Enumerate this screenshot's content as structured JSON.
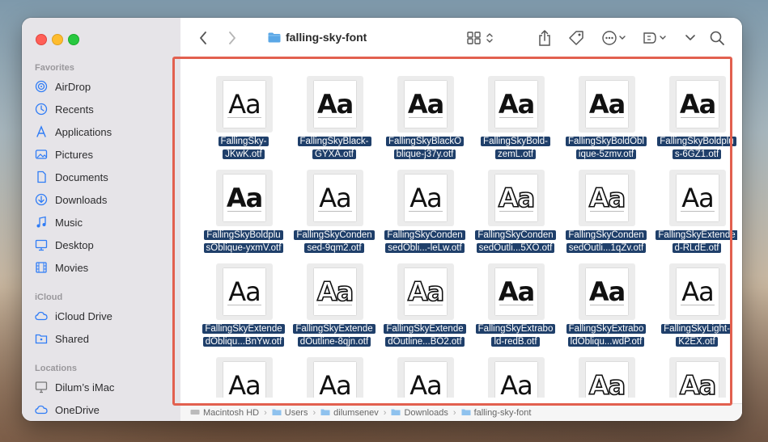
{
  "window": {
    "title": "falling-sky-font",
    "highlight_color": "#e2604f"
  },
  "sidebar": {
    "favorites_title": "Favorites",
    "favorites": [
      {
        "label": "AirDrop",
        "icon": "airdrop-icon"
      },
      {
        "label": "Recents",
        "icon": "clock-icon"
      },
      {
        "label": "Applications",
        "icon": "applications-icon"
      },
      {
        "label": "Pictures",
        "icon": "pictures-icon"
      },
      {
        "label": "Documents",
        "icon": "document-icon"
      },
      {
        "label": "Downloads",
        "icon": "download-icon"
      },
      {
        "label": "Music",
        "icon": "music-icon"
      },
      {
        "label": "Desktop",
        "icon": "desktop-icon"
      },
      {
        "label": "Movies",
        "icon": "movies-icon"
      }
    ],
    "icloud_title": "iCloud",
    "icloud": [
      {
        "label": "iCloud Drive",
        "icon": "cloud-icon"
      },
      {
        "label": "Shared",
        "icon": "shared-folder-icon"
      }
    ],
    "locations_title": "Locations",
    "locations": [
      {
        "label": "Dilum’s iMac",
        "icon": "imac-icon"
      },
      {
        "label": "OneDrive",
        "icon": "cloud-icon"
      }
    ]
  },
  "files": [
    {
      "line1": "FallingSky-",
      "line2": "JKwK.otf",
      "style": "regular"
    },
    {
      "line1": "FallingSkyBlack-",
      "line2": "GYXA.otf",
      "style": "black"
    },
    {
      "line1": "FallingSkyBlackO",
      "line2": "blique-j37y.otf",
      "style": "black"
    },
    {
      "line1": "FallingSkyBold-",
      "line2": "zemL.otf",
      "style": "black"
    },
    {
      "line1": "FallingSkyBoldObl",
      "line2": "ique-5zmv.otf",
      "style": "black"
    },
    {
      "line1": "FallingSkyBoldplu",
      "line2": "s-6GZ1.otf",
      "style": "black"
    },
    {
      "line1": "FallingSkyBoldplu",
      "line2": "sOblique-yxmV.otf",
      "style": "black"
    },
    {
      "line1": "FallingSkyConden",
      "line2": "sed-9qm2.otf",
      "style": "regular"
    },
    {
      "line1": "FallingSkyConden",
      "line2": "sedObli...-leLw.otf",
      "style": "regular"
    },
    {
      "line1": "FallingSkyConden",
      "line2": "sedOutli...5XO.otf",
      "style": "outline"
    },
    {
      "line1": "FallingSkyConden",
      "line2": "sedOutli...1qZv.otf",
      "style": "outline"
    },
    {
      "line1": "FallingSkyExtende",
      "line2": "d-RLdE.otf",
      "style": "regular"
    },
    {
      "line1": "FallingSkyExtende",
      "line2": "dObliqu...BnYw.otf",
      "style": "regular"
    },
    {
      "line1": "FallingSkyExtende",
      "line2": "dOutline-8qjn.otf",
      "style": "outline"
    },
    {
      "line1": "FallingSkyExtende",
      "line2": "dOutline...BO2.otf",
      "style": "outline"
    },
    {
      "line1": "FallingSkyExtrabo",
      "line2": "ld-redB.otf",
      "style": "black"
    },
    {
      "line1": "FallingSkyExtrabo",
      "line2": "ldObliqu...wdP.otf",
      "style": "black"
    },
    {
      "line1": "FallingSkyLight-",
      "line2": "K2EX.otf",
      "style": "light"
    },
    {
      "line1": "",
      "line2": "",
      "style": "regular"
    },
    {
      "line1": "",
      "line2": "",
      "style": "regular"
    },
    {
      "line1": "",
      "line2": "",
      "style": "regular"
    },
    {
      "line1": "",
      "line2": "",
      "style": "regular"
    },
    {
      "line1": "",
      "line2": "",
      "style": "outline"
    },
    {
      "line1": "",
      "line2": "",
      "style": "outline"
    }
  ],
  "thumbnail_text": "Aa",
  "pathbar": [
    "Macintosh HD",
    "Users",
    "dilumsenev",
    "Downloads",
    "falling-sky-font"
  ]
}
